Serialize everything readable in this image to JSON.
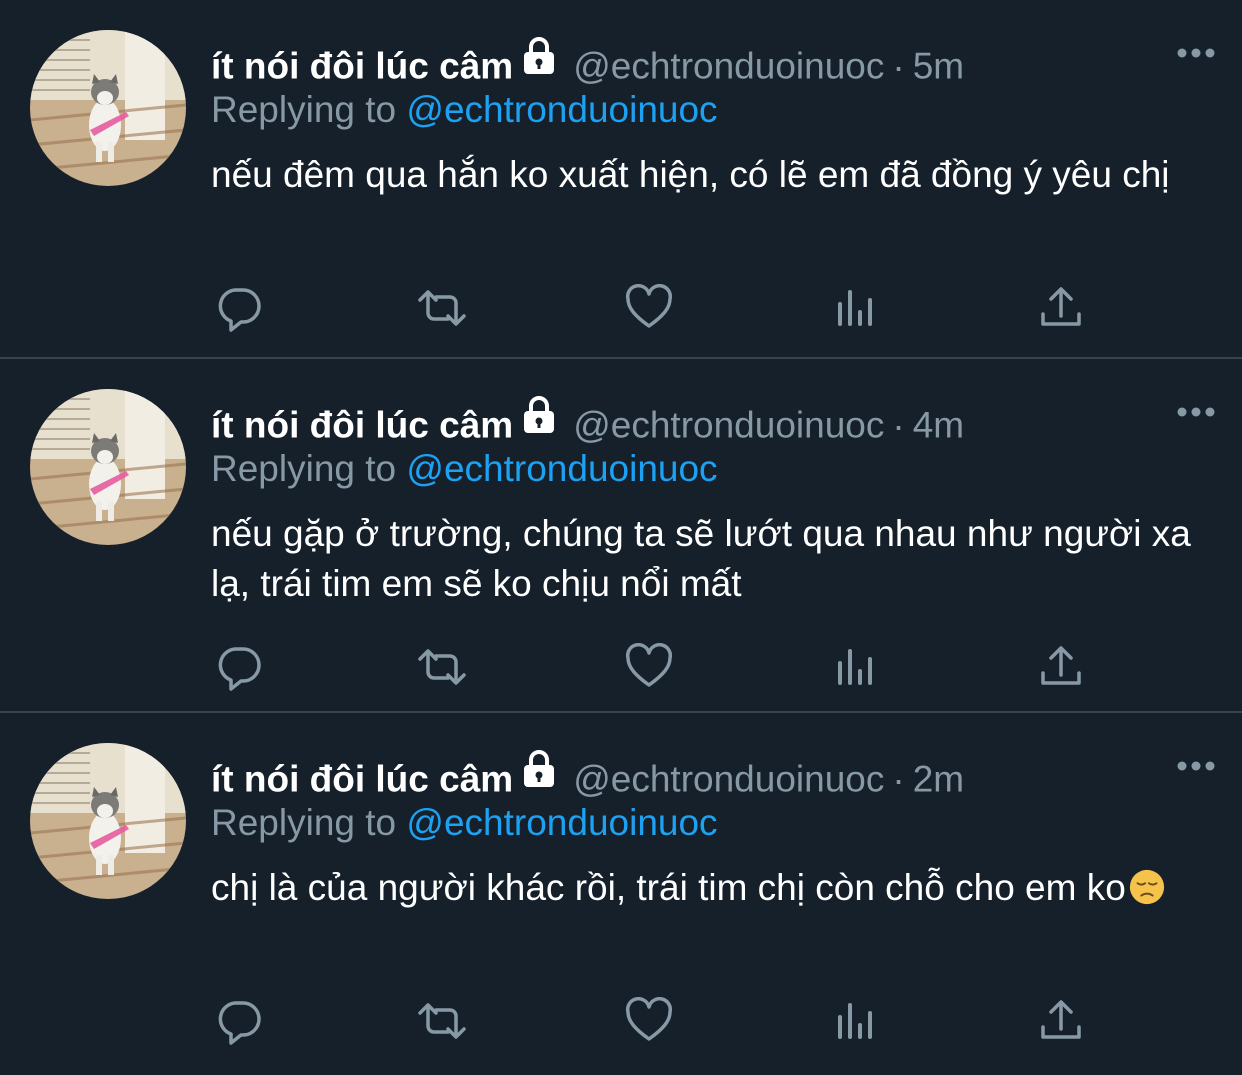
{
  "tweets": [
    {
      "name": "ít nói đôi lúc câm",
      "handle": "@echtronduoinuoc",
      "separator": "·",
      "time": "5m",
      "replying_label": "Replying to",
      "replying_to": "@echtronduoinuoc",
      "text": "nếu đêm qua hắn ko xuất hiện, có lẽ em đã đồng ý yêu chị",
      "emoji": ""
    },
    {
      "name": "ít nói đôi lúc câm",
      "handle": "@echtronduoinuoc",
      "separator": "·",
      "time": "4m",
      "replying_label": "Replying to",
      "replying_to": "@echtronduoinuoc",
      "text": "nếu gặp ở trường, chúng ta sẽ lướt qua nhau như người xa lạ, trái tim em sẽ ko chịu nổi mất",
      "emoji": ""
    },
    {
      "name": "ít nói đôi lúc câm",
      "handle": "@echtronduoinuoc",
      "separator": "·",
      "time": "2m",
      "replying_label": "Replying to",
      "replying_to": "@echtronduoinuoc",
      "text": "chị là của người khác rồi, trái tim chị còn chỗ cho em ko",
      "emoji": "disappointed-face"
    }
  ],
  "icons": {
    "reply": "reply-icon",
    "retweet": "retweet-icon",
    "like": "heart-icon",
    "analytics": "analytics-icon",
    "share": "share-icon",
    "more": "more-icon",
    "protected": "lock-icon"
  },
  "colors": {
    "background": "#15202b",
    "secondary_text": "#8899a6",
    "mention": "#1da1f2",
    "divider": "#38444d"
  }
}
